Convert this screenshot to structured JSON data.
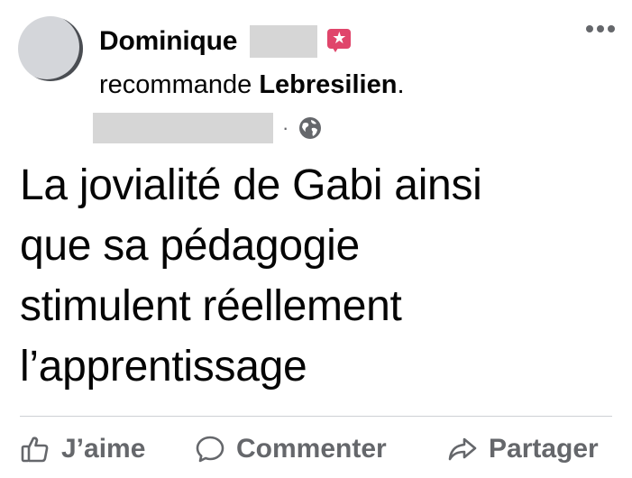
{
  "post": {
    "author_name": "Dominique",
    "recommend_verb": "recommande ",
    "recommended_page": "Lebresilien",
    "recommended_suffix": ".",
    "separator": "·",
    "text_lines": [
      "La jovialité de Gabi ainsi",
      "que sa pédagogie",
      "stimulent réellement",
      "l’apprentissage"
    ]
  },
  "actions": {
    "like_label": "J’aime",
    "comment_label": "Commenter",
    "share_label": "Partager"
  },
  "colors": {
    "recommend_badge": "#e0456b",
    "secondary_text": "#65676b",
    "primary_text": "#050505"
  },
  "icons": [
    "recommend-icon",
    "globe-icon",
    "more-icon",
    "like-icon",
    "comment-icon",
    "share-icon"
  ]
}
